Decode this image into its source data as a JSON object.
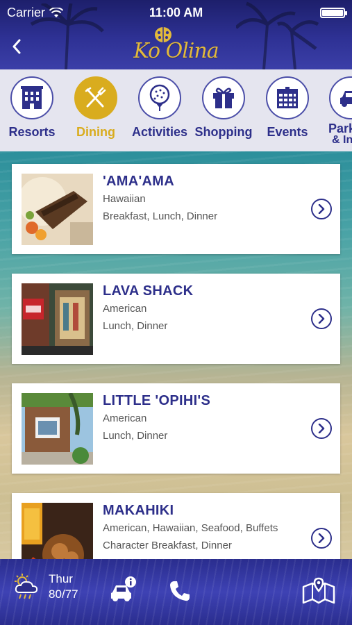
{
  "status_bar": {
    "carrier": "Carrier",
    "time": "11:00 AM",
    "battery_level": 1.0
  },
  "header": {
    "logo_text": "Ko Olina"
  },
  "categories": [
    {
      "label": "Resorts",
      "icon": "building-icon",
      "active": false
    },
    {
      "label": "Dining",
      "icon": "fork-knife-icon",
      "active": true
    },
    {
      "label": "Activities",
      "icon": "golf-ball-icon",
      "active": false
    },
    {
      "label": "Shopping",
      "icon": "gift-icon",
      "active": false
    },
    {
      "label": "Events",
      "icon": "calendar-icon",
      "active": false
    },
    {
      "label": "Park",
      "label2": "& In",
      "icon": "car-icon",
      "active": false
    }
  ],
  "restaurants": [
    {
      "name": "'AMA'AMA",
      "cuisine": "Hawaiian",
      "meals": "Breakfast, Lunch, Dinner"
    },
    {
      "name": "LAVA SHACK",
      "cuisine": "American",
      "meals": "Lunch, Dinner"
    },
    {
      "name": "LITTLE 'OPIHI'S",
      "cuisine": "American",
      "meals": "Lunch, Dinner"
    },
    {
      "name": "MAKAHIKI",
      "cuisine": "American, Hawaiian, Seafood, Buffets",
      "meals": "Character Breakfast, Dinner"
    }
  ],
  "bottom_bar": {
    "weather": {
      "day": "Thur",
      "temps": "80/77",
      "icon": "cloud-sun-rain-icon"
    },
    "buttons": [
      "car-info-icon",
      "phone-icon",
      "map-icon"
    ]
  },
  "colors": {
    "brand_navy": "#2d2f8a",
    "accent_gold": "#d9ac1e"
  }
}
